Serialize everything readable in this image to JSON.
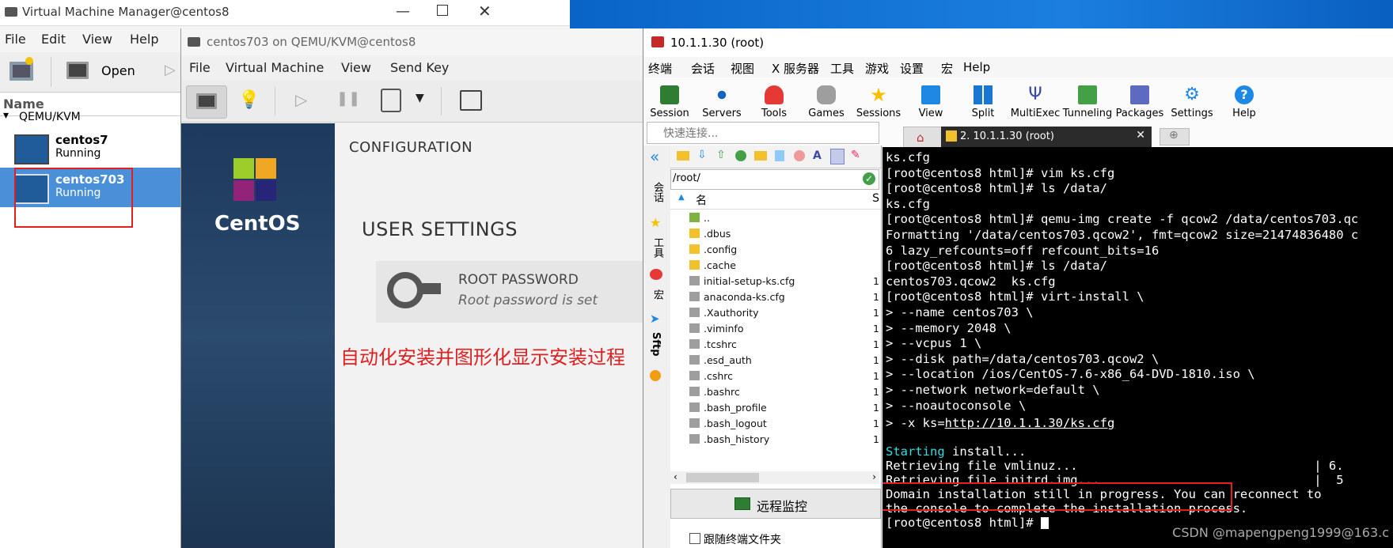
{
  "vmm": {
    "title": "Virtual Machine Manager@centos8",
    "menu": [
      "File",
      "Edit",
      "View",
      "Help"
    ],
    "toolbar_open": "Open",
    "list_header": "Name",
    "group": "QEMU/KVM",
    "vms": [
      {
        "name": "centos7",
        "status": "Running"
      },
      {
        "name": "centos703",
        "status": "Running"
      }
    ]
  },
  "qemu": {
    "title": "centos703 on QEMU/KVM@centos8",
    "menu": [
      "File",
      "Virtual Machine",
      "View",
      "Send Key"
    ],
    "brand": "CentOS",
    "config_title": "CONFIGURATION",
    "user_settings": "USER SETTINGS",
    "root_pw_title": "ROOT PASSWORD",
    "root_pw_sub": "Root password is set",
    "annotation": "自动化安装并图形化显示安装过程"
  },
  "xshell": {
    "title": "10.1.1.30 (root)",
    "menu": [
      "终端",
      "会话",
      "视图",
      "X 服务器",
      "工具",
      "游戏",
      "设置",
      "宏",
      "Help"
    ],
    "tools": [
      "Session",
      "Servers",
      "Tools",
      "Games",
      "Sessions",
      "View",
      "Split",
      "MultiExec",
      "Tunneling",
      "Packages",
      "Settings",
      "Help"
    ],
    "quick_connect": "快速连接...",
    "vtabs": [
      "会话",
      "工具",
      "宏",
      "Sftp"
    ],
    "sftp_path": "/root/",
    "sftp_col_name": "名",
    "sftp_col_size": "S",
    "files": [
      {
        "name": "..",
        "size": ""
      },
      {
        "name": ".dbus",
        "size": ""
      },
      {
        "name": ".config",
        "size": ""
      },
      {
        "name": ".cache",
        "size": ""
      },
      {
        "name": "initial-setup-ks.cfg",
        "size": "1"
      },
      {
        "name": "anaconda-ks.cfg",
        "size": "1"
      },
      {
        "name": ".Xauthority",
        "size": "1"
      },
      {
        "name": ".viminfo",
        "size": "1"
      },
      {
        "name": ".tcshrc",
        "size": "1"
      },
      {
        "name": ".esd_auth",
        "size": "1"
      },
      {
        "name": ".cshrc",
        "size": "1"
      },
      {
        "name": ".bashrc",
        "size": "1"
      },
      {
        "name": ".bash_profile",
        "size": "1"
      },
      {
        "name": ".bash_logout",
        "size": "1"
      },
      {
        "name": ".bash_history",
        "size": "1"
      }
    ],
    "monitor_btn": "远程监控",
    "follow_label": "跟随终端文件夹",
    "tab_active": "2. 10.1.1.30 (root)",
    "terminal": [
      "ks.cfg",
      "[root@centos8 html]# vim ks.cfg",
      "[root@centos8 html]# ls /data/",
      "ks.cfg",
      "[root@centos8 html]# qemu-img create -f qcow2 /data/centos703.qc",
      "Formatting '/data/centos703.qcow2', fmt=qcow2 size=21474836480 c",
      "6 lazy_refcounts=off refcount_bits=16",
      "[root@centos8 html]# ls /data/",
      "centos703.qcow2  ks.cfg",
      "[root@centos8 html]# virt-install \\",
      "> --name centos703 \\",
      "> --memory 2048 \\",
      "> --vcpus 1 \\",
      "> --disk path=/data/centos703.qcow2 \\",
      "> --location /ios/CentOS-7.6-x86_64-DVD-1810.iso \\",
      "> --network network=default \\",
      "> --noautoconsole \\"
    ],
    "ks_prefix": "> -x ks=",
    "ks_url": "http://10.1.1.30/ks.cfg",
    "starting_label": "Starting",
    "starting_rest": " install...",
    "retr1": "Retrieving file vmlinuz...                                | 6.",
    "retr2": "Retrieving file initrd.img...                             |  5",
    "domain1": "Domain installation still in progress. You can reconnect to",
    "domain2": "the console to complete the installation process.",
    "prompt": "[root@centos8 html]# ",
    "watermark": "CSDN @mapengpeng1999@163.c"
  }
}
